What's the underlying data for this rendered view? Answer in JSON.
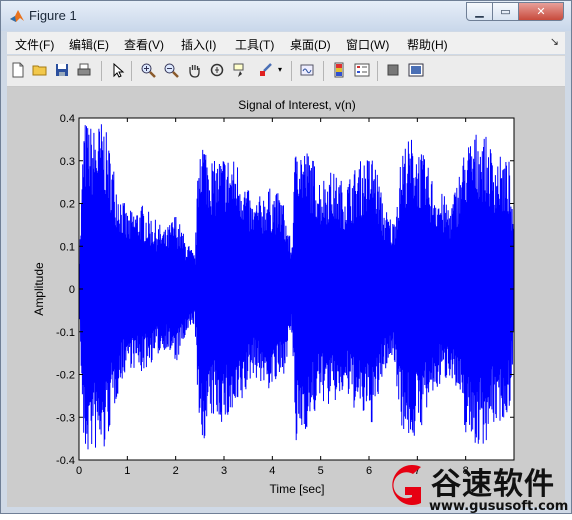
{
  "window": {
    "title": "Figure 1"
  },
  "menu": [
    "文件(F)",
    "编辑(E)",
    "查看(V)",
    "插入(I)",
    "工具(T)",
    "桌面(D)",
    "窗口(W)",
    "帮助(H)"
  ],
  "toolbar_icons": [
    "new-figure-icon",
    "open-file-icon",
    "save-icon",
    "print-icon",
    "edit-plot-icon",
    "zoom-in-icon",
    "zoom-out-icon",
    "pan-icon",
    "rotate-3d-icon",
    "data-cursor-icon",
    "brush-icon",
    "brush-menu-icon",
    "link-plot-icon",
    "colorbar-icon",
    "legend-icon",
    "hide-plot-tools-icon",
    "show-plot-tools-icon"
  ],
  "chart_data": {
    "type": "line",
    "title": "Signal of Interest, v(n)",
    "xlabel": "Time [sec]",
    "ylabel": "Amplitude",
    "xlim": [
      0,
      9
    ],
    "ylim": [
      -0.4,
      0.4
    ],
    "xticks": [
      "0",
      "1",
      "2",
      "3",
      "4",
      "5",
      "6",
      "7",
      "8"
    ],
    "yticks": [
      "-0.4",
      "-0.3",
      "-0.2",
      "-0.1",
      "0",
      "0.1",
      "0.2",
      "0.3",
      "0.4"
    ],
    "grid": false,
    "line_color": "#0000ff",
    "series": [
      {
        "envelope_time": [
          0.0,
          0.1,
          0.3,
          0.5,
          0.8,
          1.0,
          1.3,
          1.6,
          1.8,
          2.0,
          2.2,
          2.4,
          2.5,
          2.6,
          2.8,
          3.0,
          3.3,
          3.6,
          3.9,
          4.2,
          4.4,
          4.5,
          4.6,
          4.8,
          5.0,
          5.2,
          5.5,
          5.8,
          6.1,
          6.3,
          6.5,
          6.7,
          6.9,
          7.1,
          7.4,
          7.7,
          8.0,
          8.3,
          8.6,
          8.9,
          9.0
        ],
        "envelope_amplitude": [
          0.04,
          0.4,
          0.38,
          0.4,
          0.25,
          0.18,
          0.2,
          0.16,
          0.14,
          0.18,
          0.12,
          0.08,
          0.4,
          0.35,
          0.3,
          0.32,
          0.3,
          0.2,
          0.24,
          0.22,
          0.1,
          0.4,
          0.34,
          0.32,
          0.26,
          0.28,
          0.25,
          0.3,
          0.32,
          0.2,
          0.16,
          0.34,
          0.36,
          0.32,
          0.24,
          0.2,
          0.34,
          0.38,
          0.32,
          0.3,
          0.12
        ]
      }
    ]
  },
  "watermark": {
    "text": "谷速软件",
    "url": "www.gususoft.com",
    "color": "#e60012"
  }
}
